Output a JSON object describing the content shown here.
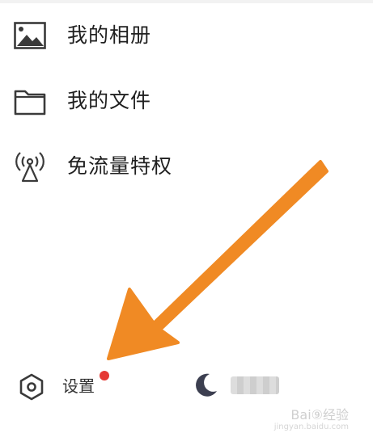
{
  "menu": {
    "items": [
      {
        "label": "我的相册",
        "icon": "photo-album-icon"
      },
      {
        "label": "我的文件",
        "icon": "folder-icon"
      },
      {
        "label": "免流量特权",
        "icon": "broadcast-tower-icon"
      }
    ]
  },
  "bottom_bar": {
    "settings_label": "设置",
    "settings_icon": "hexagon-settings-icon",
    "settings_badge_color": "#e53935",
    "night_icon": "moon-icon"
  },
  "watermark": {
    "text": "Bai⑨经验",
    "sub": "jingyan.baidu.com"
  },
  "colors": {
    "arrow": "#f08a24",
    "icon": "#3a3a3a",
    "moon": "#3c3f50"
  }
}
